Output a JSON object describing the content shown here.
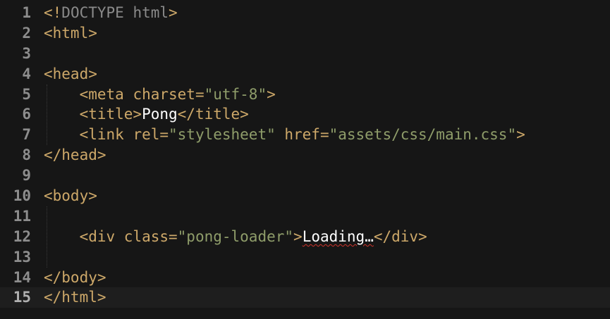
{
  "editor": {
    "theme": {
      "background": "#161616",
      "tag": "#cda869",
      "string": "#8f9d6a",
      "doctype": "#8a8a8a",
      "text": "#ffffff",
      "gutter": "#8d8d8d"
    },
    "current_line": 15,
    "lines": [
      {
        "n": "1",
        "parts": [
          {
            "c": "tag",
            "t": "<!"
          },
          {
            "c": "doctype",
            "t": "DOCTYPE html"
          },
          {
            "c": "tag",
            "t": ">"
          }
        ]
      },
      {
        "n": "2",
        "parts": [
          {
            "c": "tag",
            "t": "<html>"
          }
        ]
      },
      {
        "n": "3",
        "parts": []
      },
      {
        "n": "4",
        "parts": [
          {
            "c": "tag",
            "t": "<head>"
          }
        ]
      },
      {
        "n": "5",
        "parts": [
          {
            "c": "tag",
            "t": "    <meta "
          },
          {
            "c": "attr",
            "t": "charset="
          },
          {
            "c": "str",
            "t": "\"utf-8\""
          },
          {
            "c": "tag",
            "t": ">"
          }
        ]
      },
      {
        "n": "6",
        "parts": [
          {
            "c": "tag",
            "t": "    <title>"
          },
          {
            "c": "text",
            "t": "Pong"
          },
          {
            "c": "tag",
            "t": "</title>"
          }
        ]
      },
      {
        "n": "7",
        "parts": [
          {
            "c": "tag",
            "t": "    <link "
          },
          {
            "c": "attr",
            "t": "rel="
          },
          {
            "c": "str",
            "t": "\"stylesheet\""
          },
          {
            "c": "attr",
            "t": " href="
          },
          {
            "c": "str",
            "t": "\"assets/css/main.css\""
          },
          {
            "c": "tag",
            "t": ">"
          }
        ]
      },
      {
        "n": "8",
        "parts": [
          {
            "c": "tag",
            "t": "</head>"
          }
        ]
      },
      {
        "n": "9",
        "parts": []
      },
      {
        "n": "10",
        "parts": [
          {
            "c": "tag",
            "t": "<body>"
          }
        ]
      },
      {
        "n": "11",
        "parts": []
      },
      {
        "n": "12",
        "parts": [
          {
            "c": "tag",
            "t": "    <div "
          },
          {
            "c": "attr",
            "t": "class="
          },
          {
            "c": "str",
            "t": "\"pong-loader\""
          },
          {
            "c": "tag",
            "t": ">"
          },
          {
            "c": "text squiggle",
            "t": "Loading…"
          },
          {
            "c": "tag",
            "t": "</div>"
          }
        ]
      },
      {
        "n": "13",
        "parts": []
      },
      {
        "n": "14",
        "parts": [
          {
            "c": "tag",
            "t": "</body>"
          }
        ]
      },
      {
        "n": "15",
        "parts": [
          {
            "c": "tag",
            "t": "</html>"
          }
        ]
      }
    ]
  }
}
